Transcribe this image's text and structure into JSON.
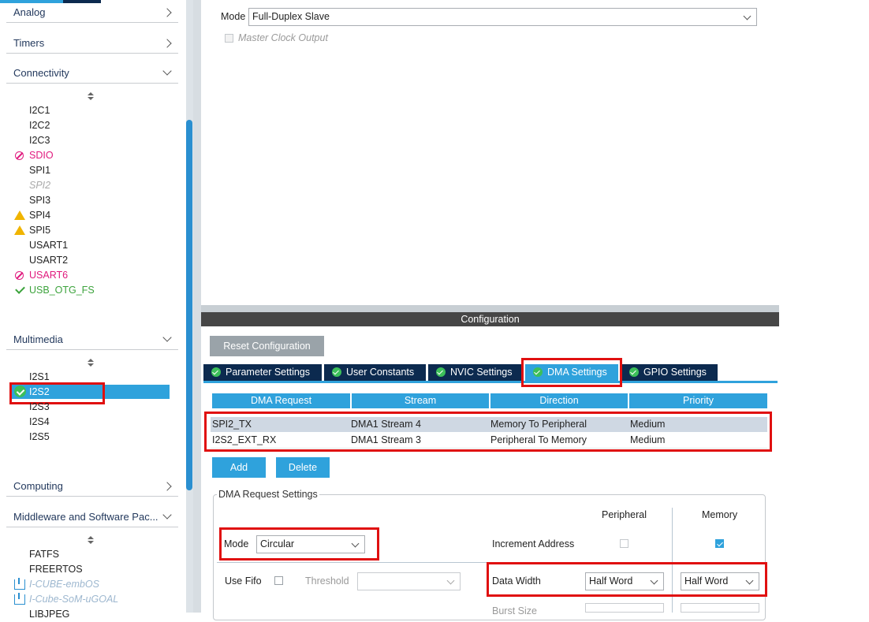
{
  "sidebar": {
    "sections": {
      "analog": "Analog",
      "timers": "Timers",
      "connectivity": "Connectivity",
      "multimedia": "Multimedia",
      "computing": "Computing",
      "middleware": "Middleware and Software Pac..."
    },
    "connectivity_items": [
      "I2C1",
      "I2C2",
      "I2C3",
      "SDIO",
      "SPI1",
      "SPI2",
      "SPI3",
      "SPI4",
      "SPI5",
      "USART1",
      "USART2",
      "USART6",
      "USB_OTG_FS"
    ],
    "multimedia_items": [
      "I2S1",
      "I2S2",
      "I2S3",
      "I2S4",
      "I2S5"
    ],
    "middleware_items": [
      "FATFS",
      "FREERTOS",
      "I-CUBE-embOS",
      "I-Cube-SoM-uGOAL",
      "LIBJPEG"
    ]
  },
  "mode_panel": {
    "mode_label": "Mode",
    "mode_value": "Full-Duplex Slave",
    "master_clock_label": "Master Clock Output"
  },
  "config": {
    "title": "Configuration",
    "reset_button": "Reset Configuration",
    "tabs": [
      "Parameter Settings",
      "User Constants",
      "NVIC Settings",
      "DMA Settings",
      "GPIO Settings"
    ],
    "active_tab": "DMA Settings",
    "table": {
      "headers": [
        "DMA Request",
        "Stream",
        "Direction",
        "Priority"
      ],
      "rows": [
        [
          "SPI2_TX",
          "DMA1 Stream 4",
          "Memory To Peripheral",
          "Medium"
        ],
        [
          "I2S2_EXT_RX",
          "DMA1 Stream 3",
          "Peripheral To Memory",
          "Medium"
        ]
      ]
    },
    "add_button": "Add",
    "delete_button": "Delete",
    "request_settings": {
      "group_title": "DMA Request Settings",
      "peripheral_header": "Peripheral",
      "memory_header": "Memory",
      "mode_label": "Mode",
      "mode_value": "Circular",
      "increment_label": "Increment Address",
      "peripheral_increment": false,
      "memory_increment": true,
      "use_fifo_label": "Use Fifo",
      "threshold_label": "Threshold",
      "data_width_label": "Data Width",
      "peripheral_width": "Half Word",
      "memory_width": "Half Word",
      "burst_size_label": "Burst Size"
    }
  },
  "colors": {
    "accent": "#2fa2dc",
    "tab_dark": "#0c2a4f",
    "highlight": "#e01010",
    "error": "#e0197d",
    "ok": "#3ca33c",
    "warning": "#f0b400"
  }
}
